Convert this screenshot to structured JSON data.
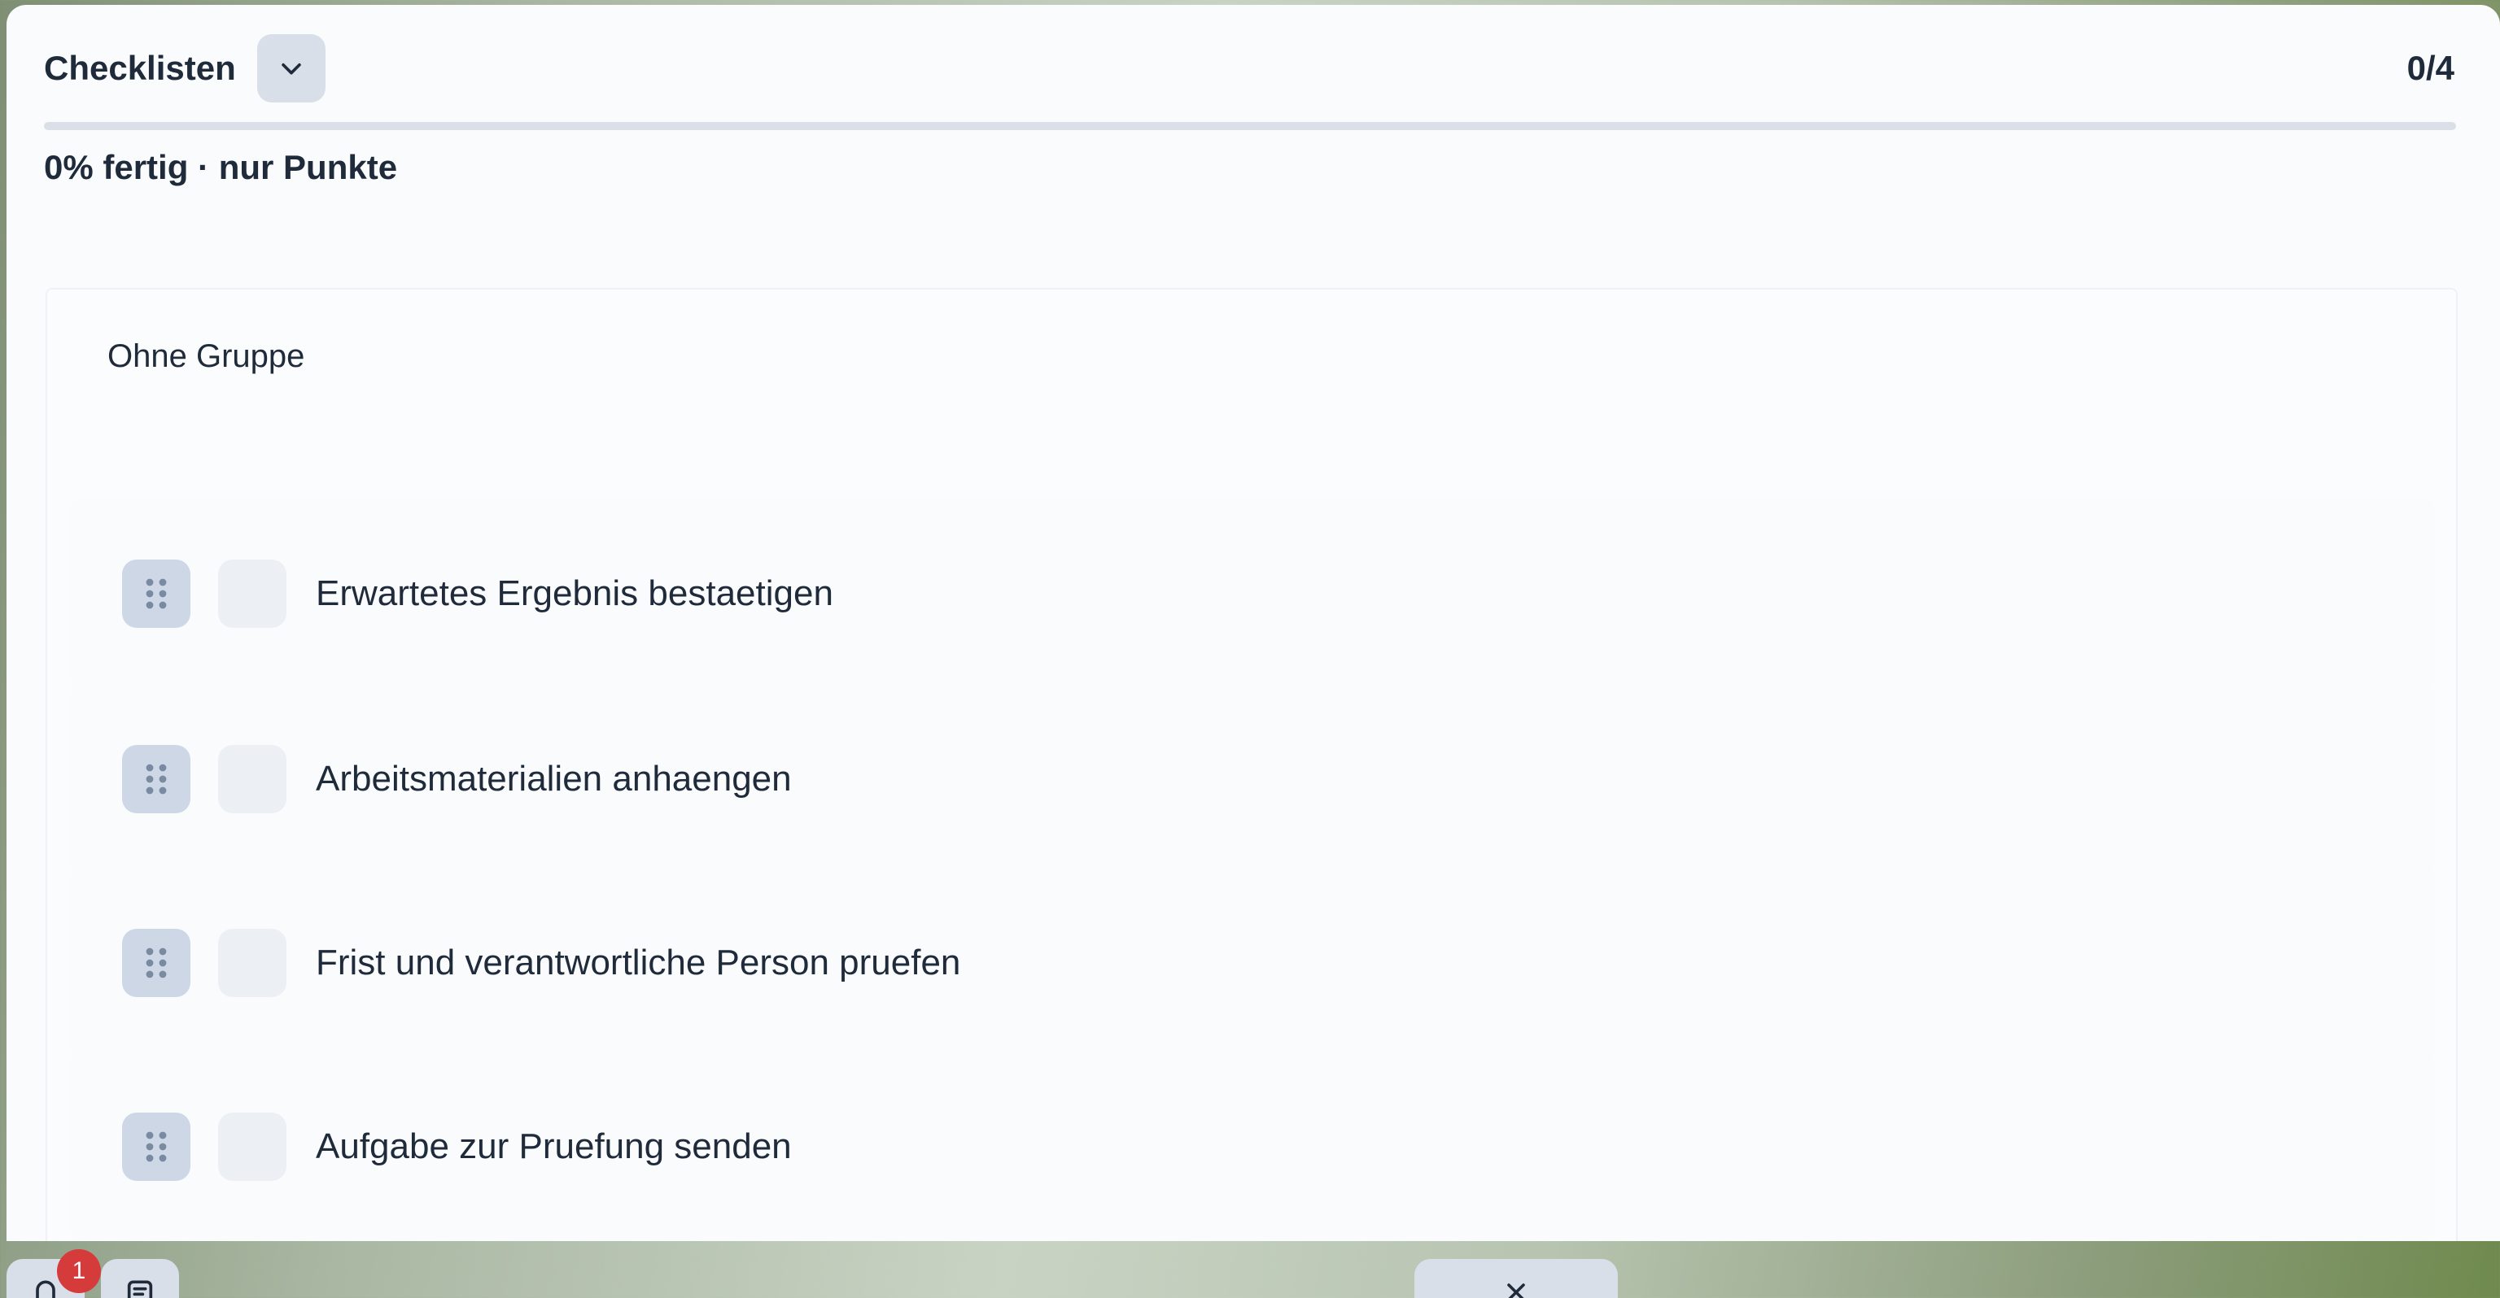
{
  "header": {
    "title": "Checklisten",
    "toggle_icon": "chevron-down-icon",
    "count": "0/4"
  },
  "progress": {
    "fraction": 0,
    "text": "0% fertig · nur Punkte"
  },
  "group": {
    "title": "Ohne Gruppe",
    "items": [
      {
        "label": "Erwartetes Ergebnis bestaetigen"
      },
      {
        "label": "Arbeitsmaterialien anhaengen"
      },
      {
        "label": "Frist und verantwortliche Person pruefen"
      },
      {
        "label": "Aufgabe zur Pruefung senden"
      }
    ]
  },
  "bottom_bar": {
    "notifications_badge": "1",
    "notification_icon": "bell-icon",
    "notes_icon": "note-icon",
    "close_icon": "close-icon"
  },
  "colors": {
    "accent": "#3d6fd8",
    "badge": "#d63b3b",
    "control": "#d9dfe9"
  }
}
